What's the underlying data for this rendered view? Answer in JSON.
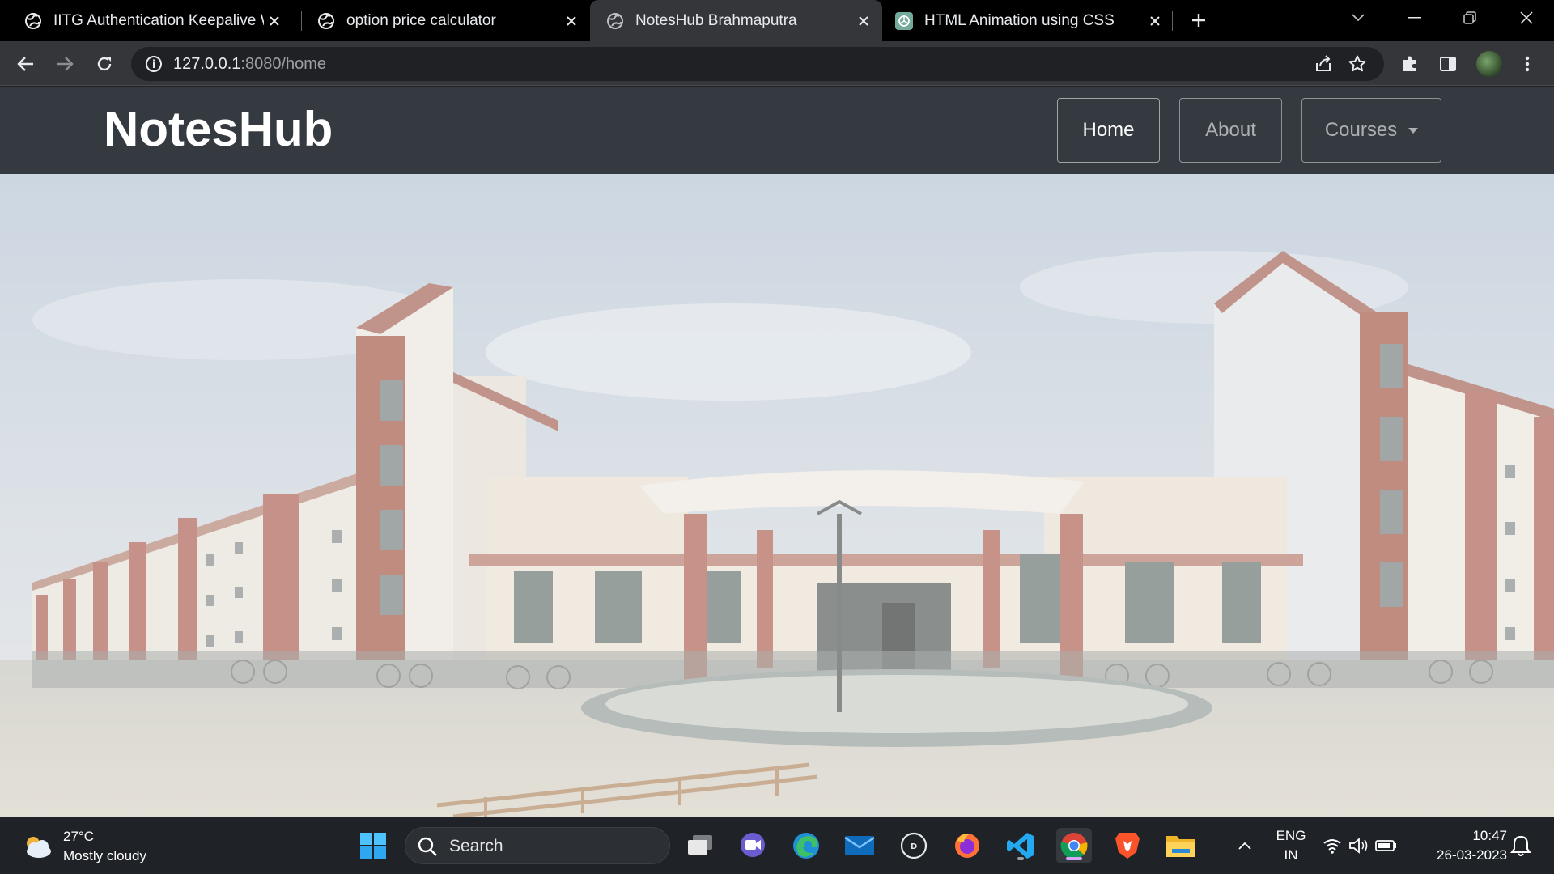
{
  "browser": {
    "tabs": [
      {
        "title": "IITG Authentication Keepalive Wi",
        "icon": "globe-icon",
        "active": false
      },
      {
        "title": "option price calculator",
        "icon": "globe-icon",
        "active": false
      },
      {
        "title": "NotesHub Brahmaputra",
        "icon": "globe-icon",
        "active": true
      },
      {
        "title": "HTML Animation using CSS",
        "icon": "chatgpt-icon",
        "active": false
      }
    ],
    "url_host": "127.0.0.1",
    "url_rest": ":8080/home"
  },
  "site": {
    "brand": "NotesHub",
    "nav": [
      {
        "label": "Home",
        "active": true
      },
      {
        "label": "About",
        "active": false
      },
      {
        "label": "Courses",
        "active": false,
        "dropdown": true
      }
    ],
    "hero_image": "campus-building-photo"
  },
  "taskbar": {
    "weather_temp": "27°C",
    "weather_desc": "Mostly cloudy",
    "search_placeholder": "Search",
    "apps": [
      "start-icon",
      "task-view-icon",
      "meet-icon",
      "edge-icon",
      "mail-icon",
      "dell-icon",
      "firefox-icon",
      "vscode-icon",
      "chrome-icon",
      "brave-icon",
      "file-explorer-icon"
    ],
    "lang_line1": "ENG",
    "lang_line2": "IN",
    "time": "10:47",
    "date": "26-03-2023"
  }
}
